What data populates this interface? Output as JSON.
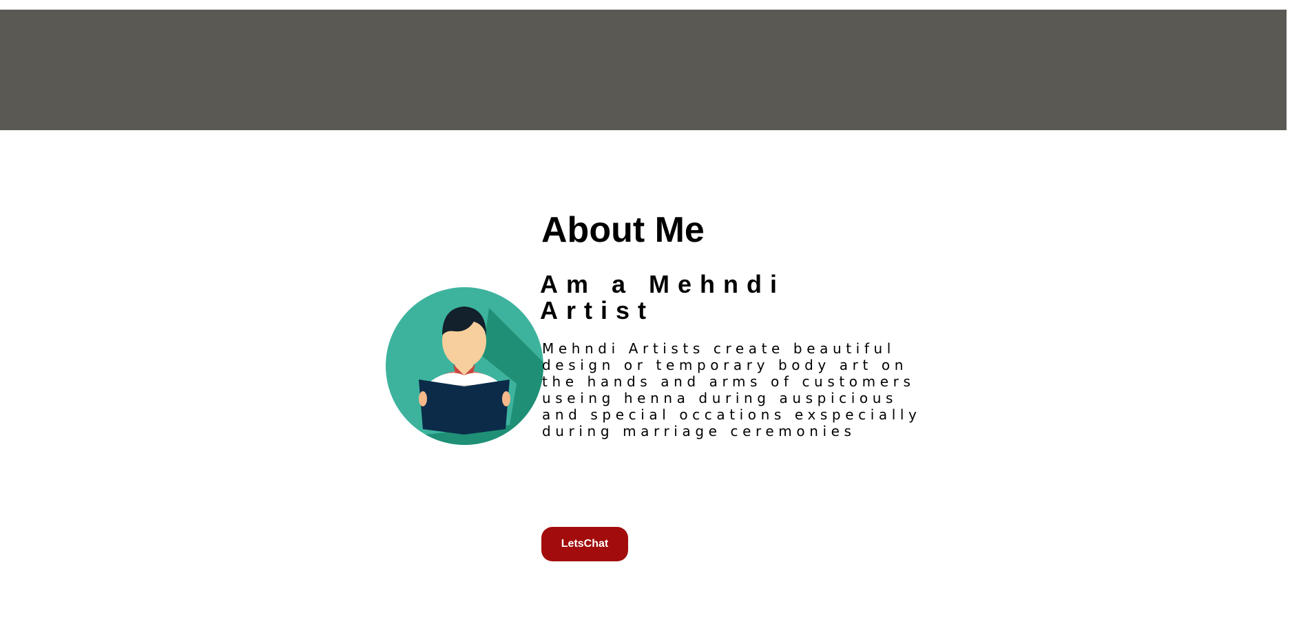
{
  "about": {
    "title": "About Me",
    "role": "Am a Mehndi Artist",
    "description": "Mehndi Artists create beautiful design or temporary body art on the hands and arms of customers useing henna during auspicious and special occations exspecially during marriage ceremonies",
    "cta_label": "LetsChat"
  },
  "avatar": {
    "icon": "reading-person-icon"
  },
  "colors": {
    "banner": "#5a5954",
    "cta": "#a20c0c",
    "avatar_bg": "#3db39e",
    "avatar_shadow": "#1f9076",
    "book": "#0b2b49"
  }
}
